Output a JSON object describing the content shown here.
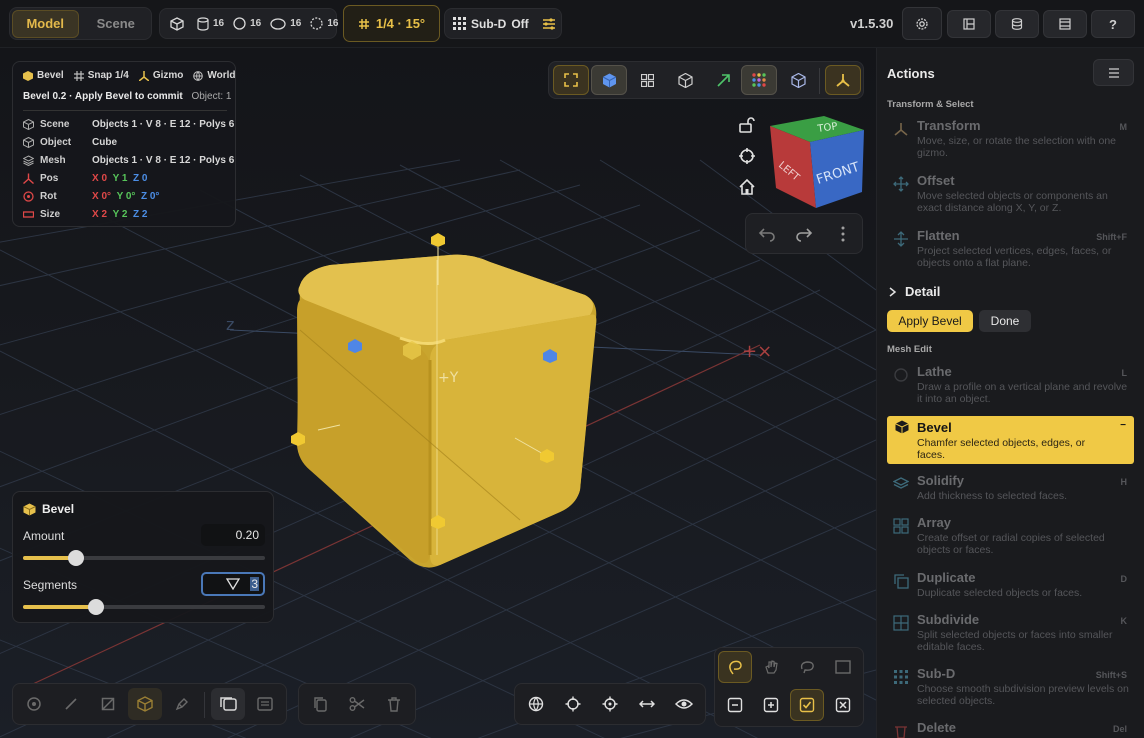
{
  "topbar": {
    "modes": [
      "Model",
      "Scene"
    ],
    "counts": [
      {
        "icon": "cube-icon",
        "value": "16"
      },
      {
        "icon": "cylinder-icon",
        "value": "16"
      },
      {
        "icon": "sphere-icon",
        "value": "16"
      },
      {
        "icon": "torus-icon",
        "value": "16"
      }
    ],
    "snap_label": "1/4 · 15°",
    "subd_label": "Sub-D",
    "subd_state": "Off",
    "version": "v1.5.30",
    "help_label": "?"
  },
  "info_panel": {
    "chips": [
      "Bevel",
      "Snap 1/4",
      "Gizmo",
      "World"
    ],
    "status": "Bevel 0.2 · Apply Bevel to commit",
    "object_count": "Object: 1",
    "rows": [
      {
        "label": "Scene",
        "value": "Objects 1 · V 8 · E 12 · Polys 6"
      },
      {
        "label": "Object",
        "value": "Cube"
      },
      {
        "label": "Mesh",
        "value": "Objects 1 · V 8 · E 12 · Polys 6"
      }
    ],
    "pos": {
      "label": "Pos",
      "x": "X 0",
      "y": "Y 1",
      "z": "Z 0"
    },
    "rot": {
      "label": "Rot",
      "x": "X 0°",
      "y": "Y 0°",
      "z": "Z 0°"
    },
    "size": {
      "label": "Size",
      "x": "X 2",
      "y": "Y 2",
      "z": "Z 2"
    }
  },
  "navcube": {
    "top": "TOP",
    "left": "LEFT",
    "front": "FRONT"
  },
  "bevel_panel": {
    "title": "Bevel",
    "amount_label": "Amount",
    "amount_value": "0.20",
    "amount_fraction": 0.22,
    "segments_label": "Segments",
    "segments_value": "3",
    "segments_fraction": 0.3
  },
  "sidebar": {
    "title": "Actions",
    "section_transform": "Transform & Select",
    "transform_actions": [
      {
        "title": "Transform",
        "desc": "Move, size, or rotate the selection with one gizmo.",
        "key": "M"
      },
      {
        "title": "Offset",
        "desc": "Move selected objects or components an exact distance along X, Y, or Z.",
        "key": ""
      },
      {
        "title": "Flatten",
        "desc": "Project selected vertices, edges, faces, or objects onto a flat plane.",
        "key": "Shift+F"
      }
    ],
    "detail_label": "Detail",
    "apply_label": "Apply Bevel",
    "done_label": "Done",
    "section_mesh": "Mesh Edit",
    "mesh_actions": [
      {
        "title": "Lathe",
        "desc": "Draw a profile on a vertical plane and revolve it into an object.",
        "key": "L"
      },
      {
        "title": "Bevel",
        "desc": "Chamfer selected objects, edges, or faces.",
        "key": "−",
        "active": true
      },
      {
        "title": "Solidify",
        "desc": "Add thickness to selected faces.",
        "key": "H"
      },
      {
        "title": "Array",
        "desc": "Create offset or radial copies of selected objects or faces.",
        "key": ""
      },
      {
        "title": "Duplicate",
        "desc": "Duplicate selected objects or faces.",
        "key": "D"
      },
      {
        "title": "Subdivide",
        "desc": "Split selected objects or faces into smaller editable faces.",
        "key": "K"
      },
      {
        "title": "Sub-D",
        "desc": "Choose smooth subdivision preview levels on selected objects.",
        "key": "Shift+S"
      },
      {
        "title": "Delete",
        "desc": "",
        "key": "Del"
      }
    ]
  },
  "colors": {
    "accent": "#e6c04c",
    "x": "#e04848",
    "y": "#57c45a",
    "z": "#4c8ee6"
  }
}
